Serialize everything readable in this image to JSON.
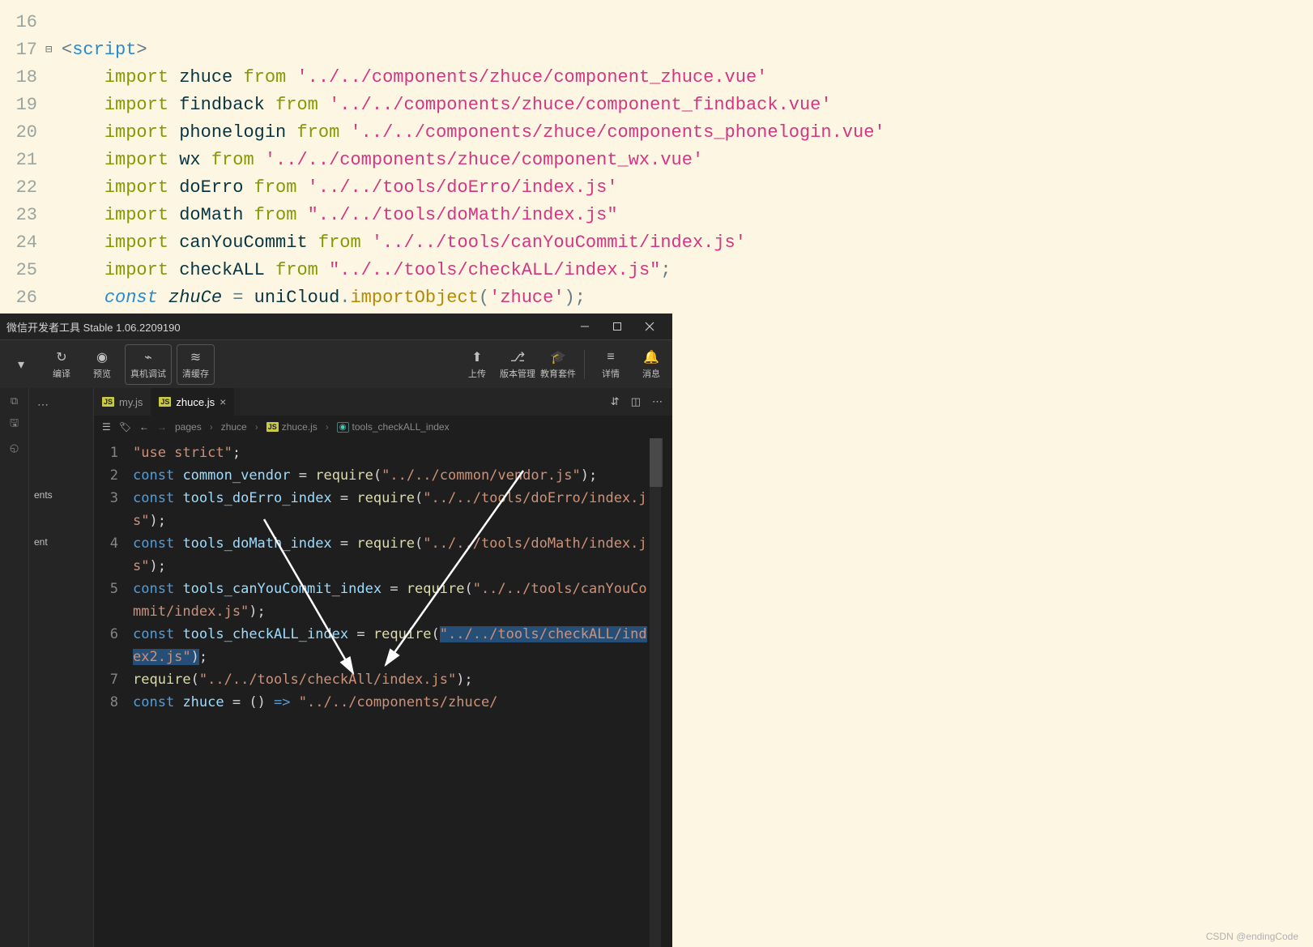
{
  "top_editor": {
    "lines": [
      {
        "num": "16",
        "segments": []
      },
      {
        "num": "17",
        "fold": true,
        "segments": [
          {
            "t": "<",
            "c": "tag-delim"
          },
          {
            "t": "script",
            "c": "tag-name"
          },
          {
            "t": ">",
            "c": "tag-delim"
          }
        ]
      },
      {
        "num": "18",
        "indent": "    ",
        "segments": [
          {
            "t": "import",
            "c": "kw-import"
          },
          {
            "t": " "
          },
          {
            "t": "zhuce",
            "c": "ident"
          },
          {
            "t": " "
          },
          {
            "t": "from",
            "c": "kw-from"
          },
          {
            "t": " "
          },
          {
            "t": "'../../components/zhuce/component_zhuce.vue'",
            "c": "string-s"
          }
        ]
      },
      {
        "num": "19",
        "indent": "    ",
        "segments": [
          {
            "t": "import",
            "c": "kw-import"
          },
          {
            "t": " "
          },
          {
            "t": "findback",
            "c": "ident"
          },
          {
            "t": " "
          },
          {
            "t": "from",
            "c": "kw-from"
          },
          {
            "t": " "
          },
          {
            "t": "'../../components/zhuce/component_findback.vue'",
            "c": "string-s"
          }
        ]
      },
      {
        "num": "20",
        "indent": "    ",
        "segments": [
          {
            "t": "import",
            "c": "kw-import"
          },
          {
            "t": " "
          },
          {
            "t": "phonelogin",
            "c": "ident"
          },
          {
            "t": " "
          },
          {
            "t": "from",
            "c": "kw-from"
          },
          {
            "t": " "
          },
          {
            "t": "'../../components/zhuce/components_phonelogin.vue'",
            "c": "string-s"
          }
        ]
      },
      {
        "num": "21",
        "indent": "    ",
        "segments": [
          {
            "t": "import",
            "c": "kw-import"
          },
          {
            "t": " "
          },
          {
            "t": "wx",
            "c": "ident"
          },
          {
            "t": " "
          },
          {
            "t": "from",
            "c": "kw-from"
          },
          {
            "t": " "
          },
          {
            "t": "'../../components/zhuce/component_wx.vue'",
            "c": "string-s"
          }
        ]
      },
      {
        "num": "22",
        "indent": "    ",
        "segments": [
          {
            "t": "import",
            "c": "kw-import"
          },
          {
            "t": " "
          },
          {
            "t": "doErro",
            "c": "ident"
          },
          {
            "t": " "
          },
          {
            "t": "from",
            "c": "kw-from"
          },
          {
            "t": " "
          },
          {
            "t": "'../../tools/doErro/index.js'",
            "c": "string-s"
          }
        ]
      },
      {
        "num": "23",
        "indent": "    ",
        "segments": [
          {
            "t": "import",
            "c": "kw-import"
          },
          {
            "t": " "
          },
          {
            "t": "doMath",
            "c": "ident"
          },
          {
            "t": " "
          },
          {
            "t": "from",
            "c": "kw-from"
          },
          {
            "t": " "
          },
          {
            "t": "\"../../tools/doMath/index.js\"",
            "c": "string-d"
          }
        ]
      },
      {
        "num": "24",
        "indent": "    ",
        "segments": [
          {
            "t": "import",
            "c": "kw-import"
          },
          {
            "t": " "
          },
          {
            "t": "canYouCommit",
            "c": "ident"
          },
          {
            "t": " "
          },
          {
            "t": "from",
            "c": "kw-from"
          },
          {
            "t": " "
          },
          {
            "t": "'../../tools/canYouCommit/index.js'",
            "c": "string-s"
          }
        ]
      },
      {
        "num": "25",
        "indent": "    ",
        "segments": [
          {
            "t": "import",
            "c": "kw-import"
          },
          {
            "t": " "
          },
          {
            "t": "checkALL",
            "c": "ident"
          },
          {
            "t": " "
          },
          {
            "t": "from",
            "c": "kw-from"
          },
          {
            "t": " "
          },
          {
            "t": "\"../../tools/checkALL/index.js\"",
            "c": "string-d"
          },
          {
            "t": ";",
            "c": "op"
          }
        ]
      },
      {
        "num": "26",
        "indent": "    ",
        "segments": [
          {
            "t": "const",
            "c": "kw-const"
          },
          {
            "t": " "
          },
          {
            "t": "zhuCe",
            "c": "ident-it"
          },
          {
            "t": " ",
            "c": "op"
          },
          {
            "t": "=",
            "c": "op"
          },
          {
            "t": " "
          },
          {
            "t": "uniCloud",
            "c": "ident"
          },
          {
            "t": ".",
            "c": "op"
          },
          {
            "t": "importObject",
            "c": "method"
          },
          {
            "t": "(",
            "c": "op"
          },
          {
            "t": "'zhuce'",
            "c": "string-s"
          },
          {
            "t": ");",
            "c": "op"
          }
        ]
      }
    ]
  },
  "wx": {
    "title": "微信开发者工具 Stable 1.06.2209190",
    "toolbar": {
      "compile": "编译",
      "preview": "预览",
      "real_debug": "真机调试",
      "clear_cache": "清缓存",
      "upload": "上传",
      "version_mgmt": "版本管理",
      "edu_suite": "教育套件",
      "details": "详情",
      "messages": "消息"
    },
    "explorer": {
      "items": [
        "ents",
        "ent"
      ]
    },
    "tabs": [
      {
        "name": "my.js",
        "active": false
      },
      {
        "name": "zhuce.js",
        "active": true
      }
    ],
    "breadcrumb": {
      "p1": "pages",
      "p2": "zhuce",
      "p3": "zhuce.js",
      "p4": "tools_checkALL_index"
    },
    "code": [
      {
        "n": "1",
        "s": [
          {
            "t": "\"use strict\"",
            "c": "wk-str"
          },
          {
            "t": ";",
            "c": "wk-pn"
          }
        ]
      },
      {
        "n": "2",
        "s": [
          {
            "t": "const",
            "c": "wk-kw"
          },
          {
            "t": " "
          },
          {
            "t": "common_vendor",
            "c": "wk-var"
          },
          {
            "t": " = ",
            "c": "wk-op"
          },
          {
            "t": "require",
            "c": "wk-fn"
          },
          {
            "t": "(",
            "c": "wk-pn"
          },
          {
            "t": "\"../../common/vendor.js\"",
            "c": "wk-str"
          },
          {
            "t": ");",
            "c": "wk-pn"
          }
        ]
      },
      {
        "n": "3",
        "s": [
          {
            "t": "const",
            "c": "wk-kw"
          },
          {
            "t": " "
          },
          {
            "t": "tools_doErro_index",
            "c": "wk-var"
          },
          {
            "t": " = ",
            "c": "wk-op"
          },
          {
            "t": "require",
            "c": "wk-fn"
          },
          {
            "t": "(",
            "c": "wk-pn"
          },
          {
            "t": "\"../../tools/doErro/index.js\"",
            "c": "wk-str"
          },
          {
            "t": ");",
            "c": "wk-pn"
          }
        ]
      },
      {
        "n": "4",
        "s": [
          {
            "t": "const",
            "c": "wk-kw"
          },
          {
            "t": " "
          },
          {
            "t": "tools_doMath_index",
            "c": "wk-var"
          },
          {
            "t": " = ",
            "c": "wk-op"
          },
          {
            "t": "require",
            "c": "wk-fn"
          },
          {
            "t": "(",
            "c": "wk-pn"
          },
          {
            "t": "\"../../tools/doMath/index.js\"",
            "c": "wk-str"
          },
          {
            "t": ");",
            "c": "wk-pn"
          }
        ]
      },
      {
        "n": "5",
        "s": [
          {
            "t": "const",
            "c": "wk-kw"
          },
          {
            "t": " "
          },
          {
            "t": "tools_canYouCommit_index",
            "c": "wk-var"
          },
          {
            "t": " = ",
            "c": "wk-op"
          },
          {
            "t": "require",
            "c": "wk-fn"
          },
          {
            "t": "(",
            "c": "wk-pn"
          },
          {
            "t": "\"../../tools/canYouCommit/index.js\"",
            "c": "wk-str"
          },
          {
            "t": ");",
            "c": "wk-pn"
          }
        ]
      },
      {
        "n": "6",
        "s": [
          {
            "t": "const",
            "c": "wk-kw"
          },
          {
            "t": " "
          },
          {
            "t": "tools_checkALL_index",
            "c": "wk-var"
          },
          {
            "t": " = ",
            "c": "wk-op"
          },
          {
            "t": "require",
            "c": "wk-fn"
          },
          {
            "t": "(",
            "c": "wk-pn"
          },
          {
            "t": "\"../../tools/checkALL/index2.js\"",
            "c": "wk-str",
            "sel": true
          },
          {
            "t": ")",
            "c": "wk-pn",
            "sel": true
          },
          {
            "t": ";",
            "c": "wk-pn"
          }
        ]
      },
      {
        "n": "7",
        "s": [
          {
            "t": "require",
            "c": "wk-fn"
          },
          {
            "t": "(",
            "c": "wk-pn"
          },
          {
            "t": "\"../../tools/checkAll/index.js\"",
            "c": "wk-str"
          },
          {
            "t": ");",
            "c": "wk-pn"
          }
        ]
      },
      {
        "n": "8",
        "s": [
          {
            "t": "const",
            "c": "wk-kw"
          },
          {
            "t": " "
          },
          {
            "t": "zhuce",
            "c": "wk-var"
          },
          {
            "t": " = () ",
            "c": "wk-op"
          },
          {
            "t": "=>",
            "c": "wk-kw"
          },
          {
            "t": " ",
            "c": "wk-op"
          },
          {
            "t": "\"../../components/zhuce/",
            "c": "wk-str"
          }
        ]
      }
    ]
  },
  "watermark": "CSDN @endingCode"
}
